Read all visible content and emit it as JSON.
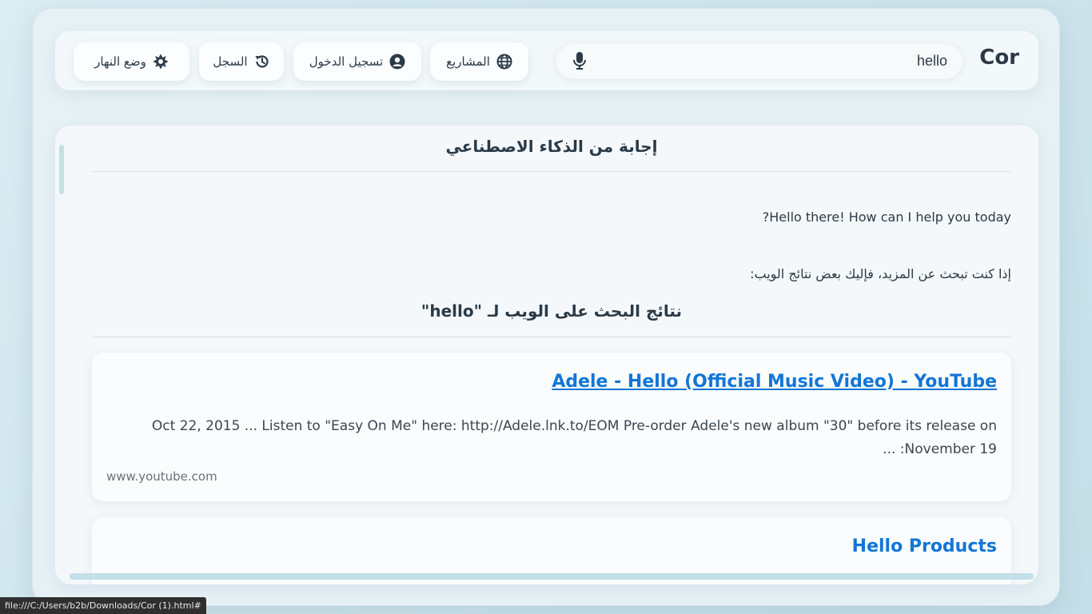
{
  "header": {
    "brand": "Cor",
    "search": {
      "value": "hello",
      "placeholder": ""
    },
    "nav": {
      "projects": "المشاريع",
      "login": "تسجيل الدخول",
      "history": "السجل",
      "day_mode": "وضع النهار"
    }
  },
  "panel": {
    "title": "إجابة من الذكاء الاصطناعي",
    "answer": "Hello there! How can I help you today?",
    "more_text": "إذا كنت تبحث عن المزيد، فإليك بعض نتائج الويب:",
    "results_title": "نتائج البحث على الويب لـ \"hello\"",
    "results": [
      {
        "title": "Adele - Hello (Official Music Video) - YouTube",
        "snippet": "Oct 22, 2015 ... Listen to \"Easy On Me\" here: http://Adele.lnk.to/EOM Pre-order Adele's new album \"30\" before its release on November 19: ...",
        "domain": "www.youtube.com"
      },
      {
        "title": "Hello Products"
      }
    ]
  },
  "status_bar": {
    "url": "file:///C:/Users/b2b/Downloads/Cor (1).html#"
  },
  "colors": {
    "link": "#1276d6",
    "text": "#2b3a47",
    "background": "#dcedf3"
  },
  "icons": [
    "microphone-icon",
    "globe-icon",
    "user-circle-icon",
    "history-icon",
    "sun-gear-icon"
  ]
}
